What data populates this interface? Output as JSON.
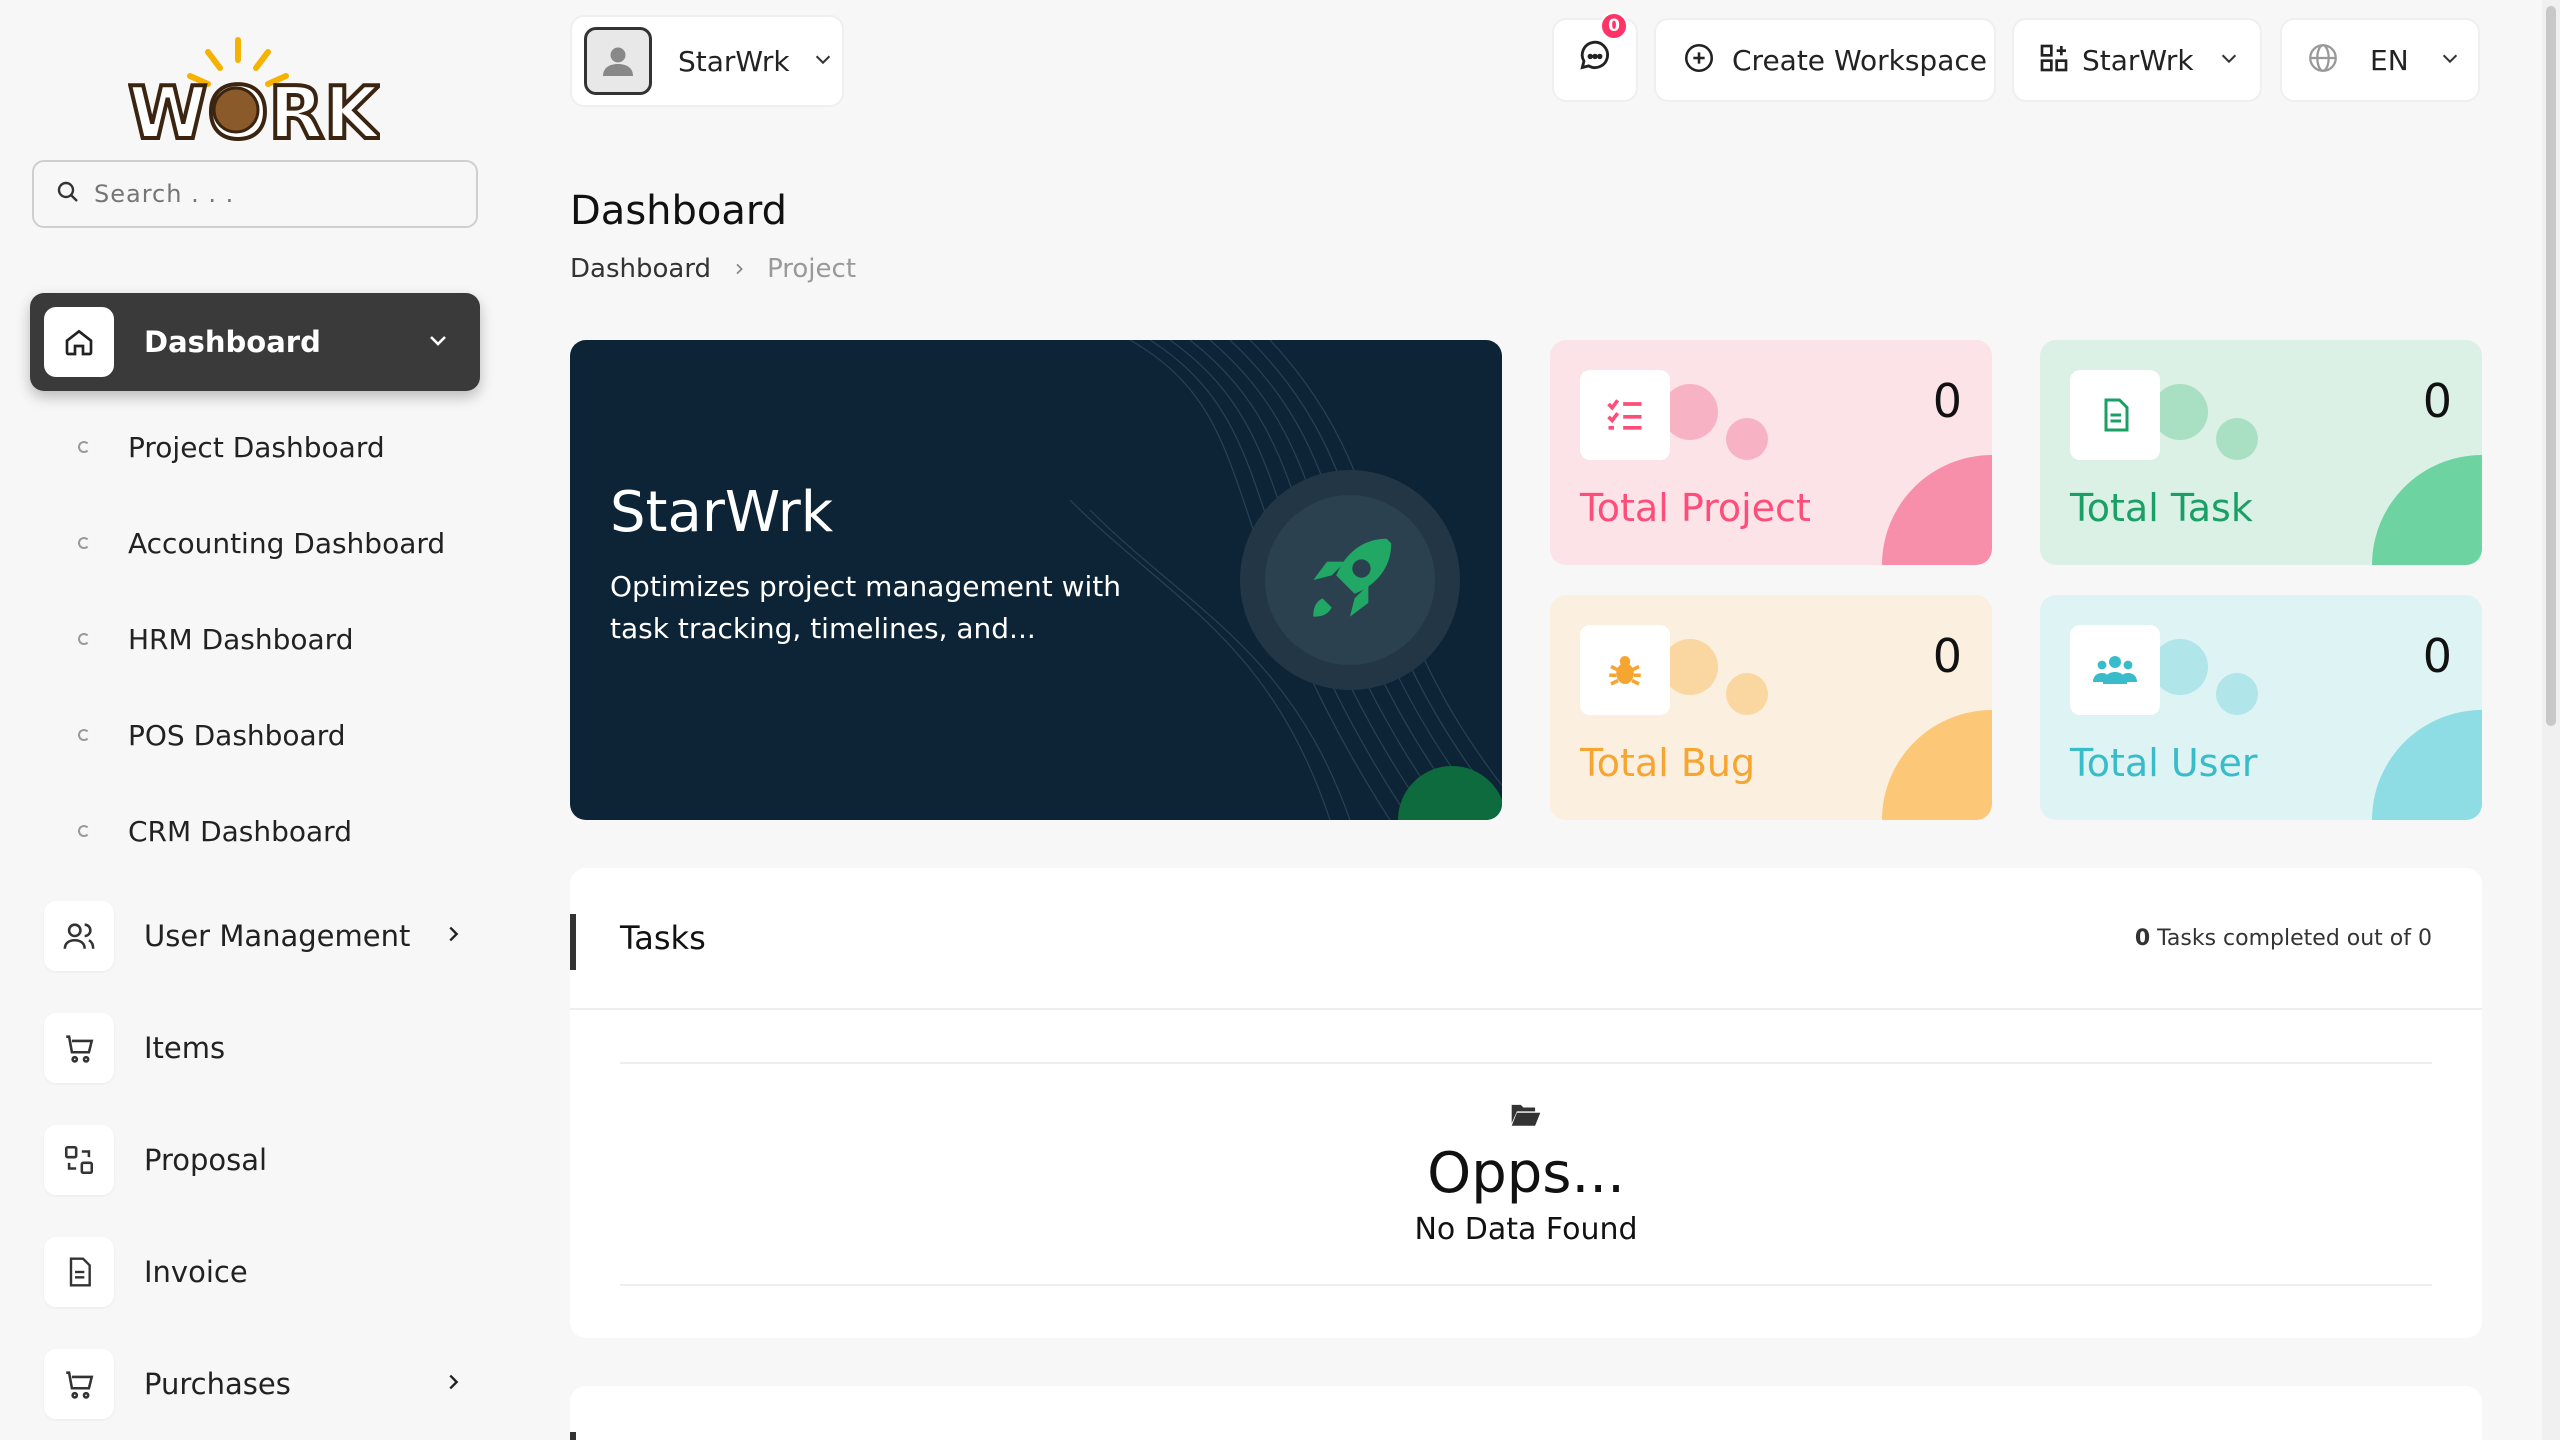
{
  "brand": {
    "logo_text": "WORK"
  },
  "search": {
    "placeholder": "Search . . ."
  },
  "sidebar": {
    "active": {
      "label": "Dashboard"
    },
    "sub_items": [
      {
        "label": "Project Dashboard"
      },
      {
        "label": "Accounting Dashboard"
      },
      {
        "label": "HRM Dashboard"
      },
      {
        "label": "POS Dashboard"
      },
      {
        "label": "CRM Dashboard"
      }
    ],
    "items": [
      {
        "label": "User Management",
        "icon": "users-icon",
        "has_chevron": true
      },
      {
        "label": "Items",
        "icon": "cart-icon",
        "has_chevron": false
      },
      {
        "label": "Proposal",
        "icon": "exchange-icon",
        "has_chevron": false
      },
      {
        "label": "Invoice",
        "icon": "document-icon",
        "has_chevron": false
      },
      {
        "label": "Purchases",
        "icon": "cart-icon",
        "has_chevron": true
      }
    ]
  },
  "topbar": {
    "workspace_user": "StarWrk",
    "notifications_count": "0",
    "create_workspace": "Create Workspace",
    "workspace": "StarWrk",
    "language": "EN"
  },
  "page": {
    "title": "Dashboard",
    "breadcrumb": [
      "Dashboard",
      "Project"
    ]
  },
  "hero": {
    "title": "StarWrk",
    "description": "Optimizes project management with task tracking, timelines, and..."
  },
  "stats": [
    {
      "label": "Total Project",
      "value": "0",
      "color": "#ff4d7a",
      "bg": "#fbe3e8",
      "blob": "#f78fab"
    },
    {
      "label": "Total Task",
      "value": "0",
      "color": "#1aa066",
      "bg": "#dcf1e6",
      "blob": "#6dd3a0"
    },
    {
      "label": "Total Bug",
      "value": "0",
      "color": "#f7a531",
      "bg": "#fbf0df",
      "blob": "#fcc776"
    },
    {
      "label": "Total User",
      "value": "0",
      "color": "#38bcc9",
      "bg": "#def3f4",
      "blob": "#8fdde4"
    }
  ],
  "tasks": {
    "title": "Tasks",
    "completed": "0",
    "meta_text": "Tasks completed out of 0",
    "empty_title": "Opps...",
    "empty_text": "No Data Found"
  },
  "colors": {
    "sidebar_active": "#3a3a3a",
    "hero_bg": "#0d2436",
    "rocket": "#22a865"
  }
}
